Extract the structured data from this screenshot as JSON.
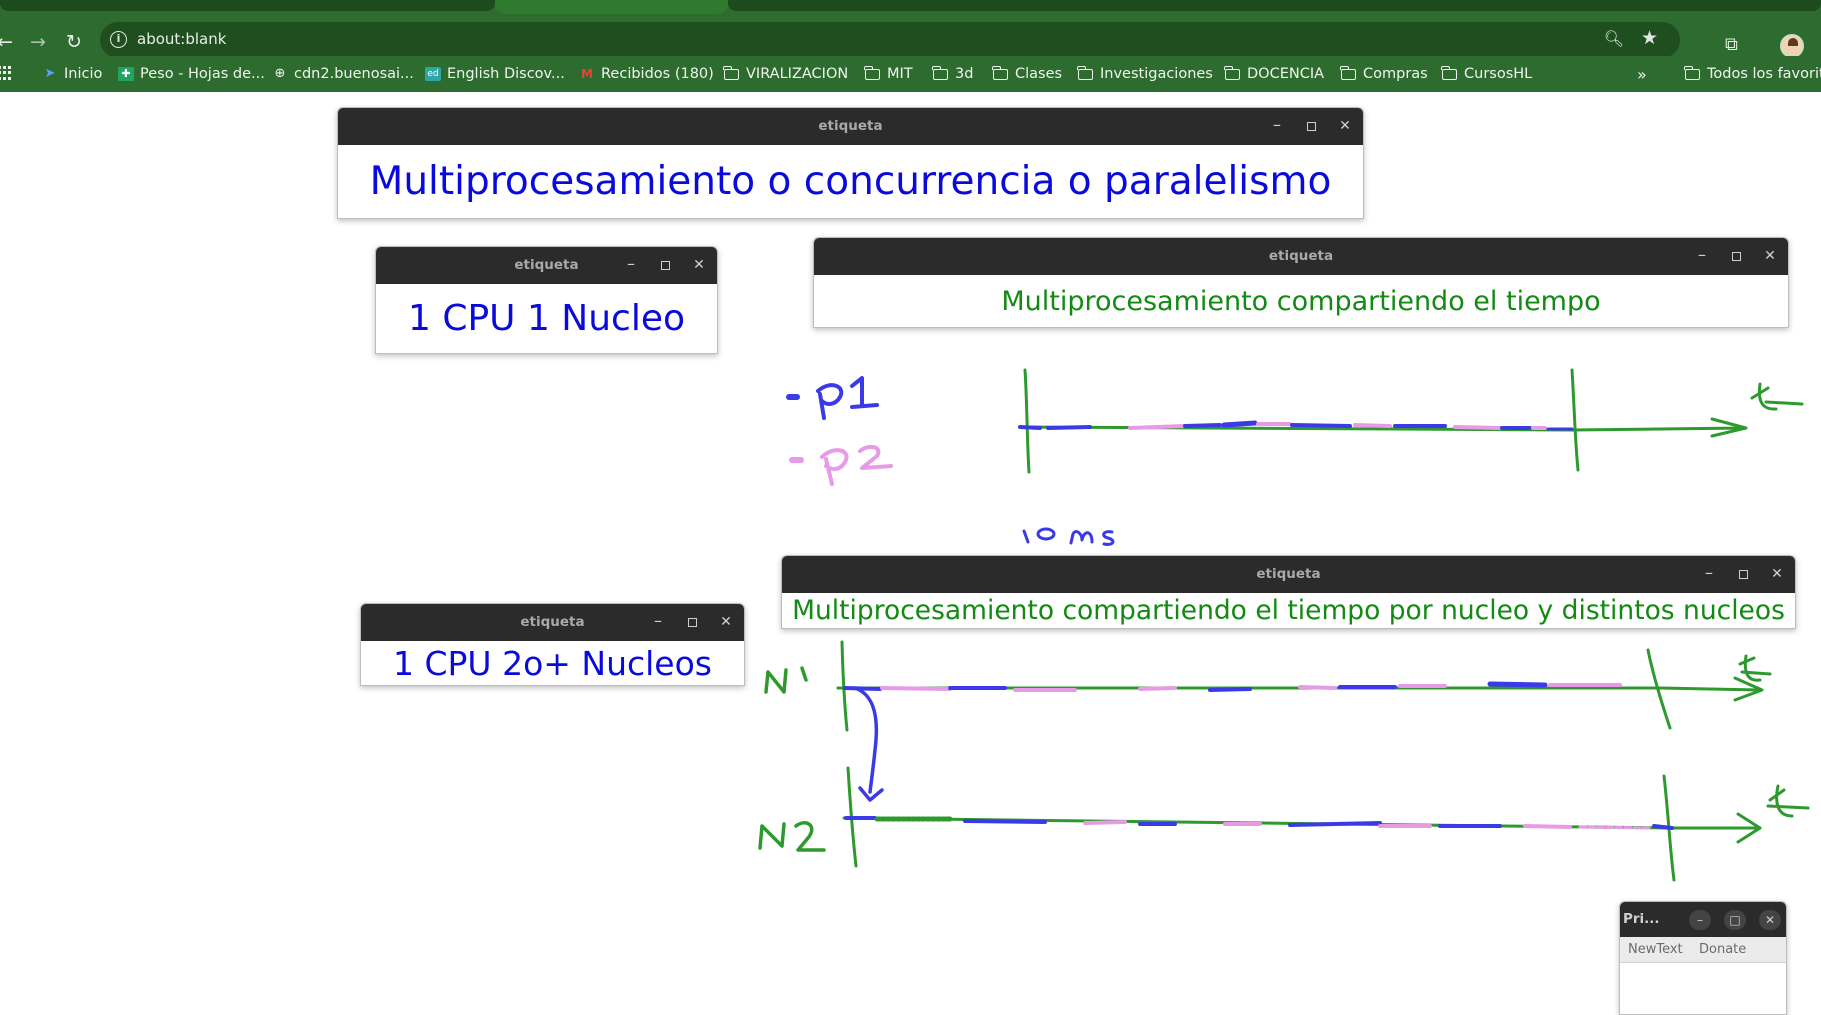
{
  "browser": {
    "url": "about:blank",
    "bookmarks": [
      {
        "label": "Inicio",
        "icon": "drive-icon"
      },
      {
        "label": "Peso - Hojas de...",
        "icon": "sheets-icon"
      },
      {
        "label": "cdn2.buenosai...",
        "icon": "globe-icon"
      },
      {
        "label": "English Discov...",
        "icon": "ed-icon"
      },
      {
        "label": "Recibidos (180)",
        "icon": "gmail-icon"
      },
      {
        "label": "VIRALIZACION",
        "icon": "folder-icon"
      },
      {
        "label": "MIT",
        "icon": "folder-icon"
      },
      {
        "label": "3d",
        "icon": "folder-icon"
      },
      {
        "label": "Clases",
        "icon": "folder-icon"
      },
      {
        "label": "Investigaciones",
        "icon": "folder-icon"
      },
      {
        "label": "DOCENCIA",
        "icon": "folder-icon"
      },
      {
        "label": "Compras",
        "icon": "folder-icon"
      },
      {
        "label": "CursosHL",
        "icon": "folder-icon"
      }
    ],
    "overflow": "»",
    "all_bookmarks": "Todos los favorit"
  },
  "windows": [
    {
      "title": "etiqueta",
      "text": "Multiprocesamiento o concurrencia o paralelismo",
      "color": "#0a0adc"
    },
    {
      "title": "etiqueta",
      "text": "1 CPU 1 Nucleo",
      "color": "#0a0adc"
    },
    {
      "title": "etiqueta",
      "text": "Multiprocesamiento compartiendo el tiempo",
      "color": "#138a13"
    },
    {
      "title": "etiqueta",
      "text": "Multiprocesamiento compartiendo el tiempo por nucleo y distintos nucleos",
      "color": "#138a13"
    },
    {
      "title": "etiqueta",
      "text": "1 CPU 2o+ Nucleos",
      "color": "#0a0adc"
    }
  ],
  "window_controls": {
    "minimize": "–",
    "maximize": "□",
    "close": "✕"
  },
  "small_window": {
    "title": "Pri...",
    "menu": [
      "NewText",
      "Donate"
    ]
  },
  "ink_colors": {
    "green": "#2e9a2e",
    "blue": "#3a3ae6",
    "pink": "#e79be6"
  }
}
